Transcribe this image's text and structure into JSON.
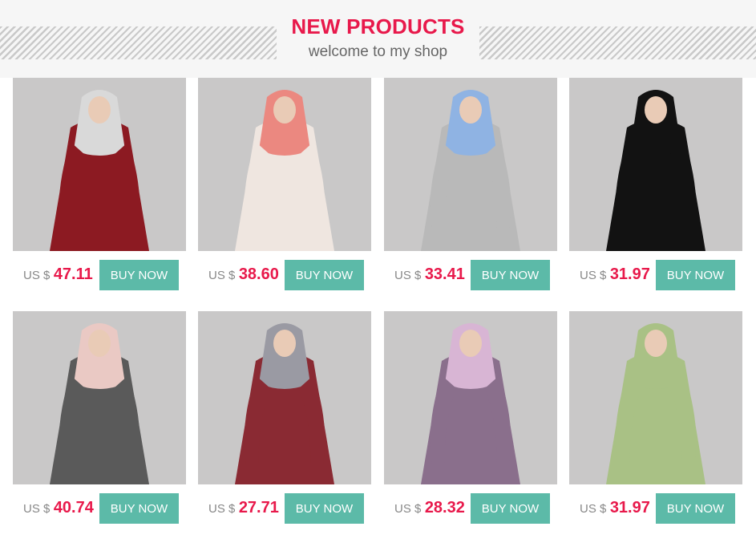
{
  "header": {
    "title": "NEW PRODUCTS",
    "subtitle": "welcome to my shop"
  },
  "products": [
    {
      "currency": "US $",
      "price": "47.11",
      "button": "BUY NOW",
      "dress": "#8c1a22",
      "scarf": "#d9d9d9"
    },
    {
      "currency": "US $",
      "price": "38.60",
      "button": "BUY NOW",
      "dress": "#efe6e0",
      "scarf": "#eb8880"
    },
    {
      "currency": "US $",
      "price": "33.41",
      "button": "BUY NOW",
      "dress": "#b9b9b9",
      "scarf": "#8fb3e3"
    },
    {
      "currency": "US $",
      "price": "31.97",
      "button": "BUY NOW",
      "dress": "#121212",
      "scarf": "#121212"
    },
    {
      "currency": "US $",
      "price": "40.74",
      "button": "BUY NOW",
      "dress": "#5a5a5a",
      "scarf": "#eac9c4"
    },
    {
      "currency": "US $",
      "price": "27.71",
      "button": "BUY NOW",
      "dress": "#8a2a33",
      "scarf": "#9a9aa3"
    },
    {
      "currency": "US $",
      "price": "28.32",
      "button": "BUY NOW",
      "dress": "#8a6f8c",
      "scarf": "#d8b5d4"
    },
    {
      "currency": "US $",
      "price": "31.97",
      "button": "BUY NOW",
      "dress": "#a9c185",
      "scarf": "#a9c185"
    }
  ]
}
